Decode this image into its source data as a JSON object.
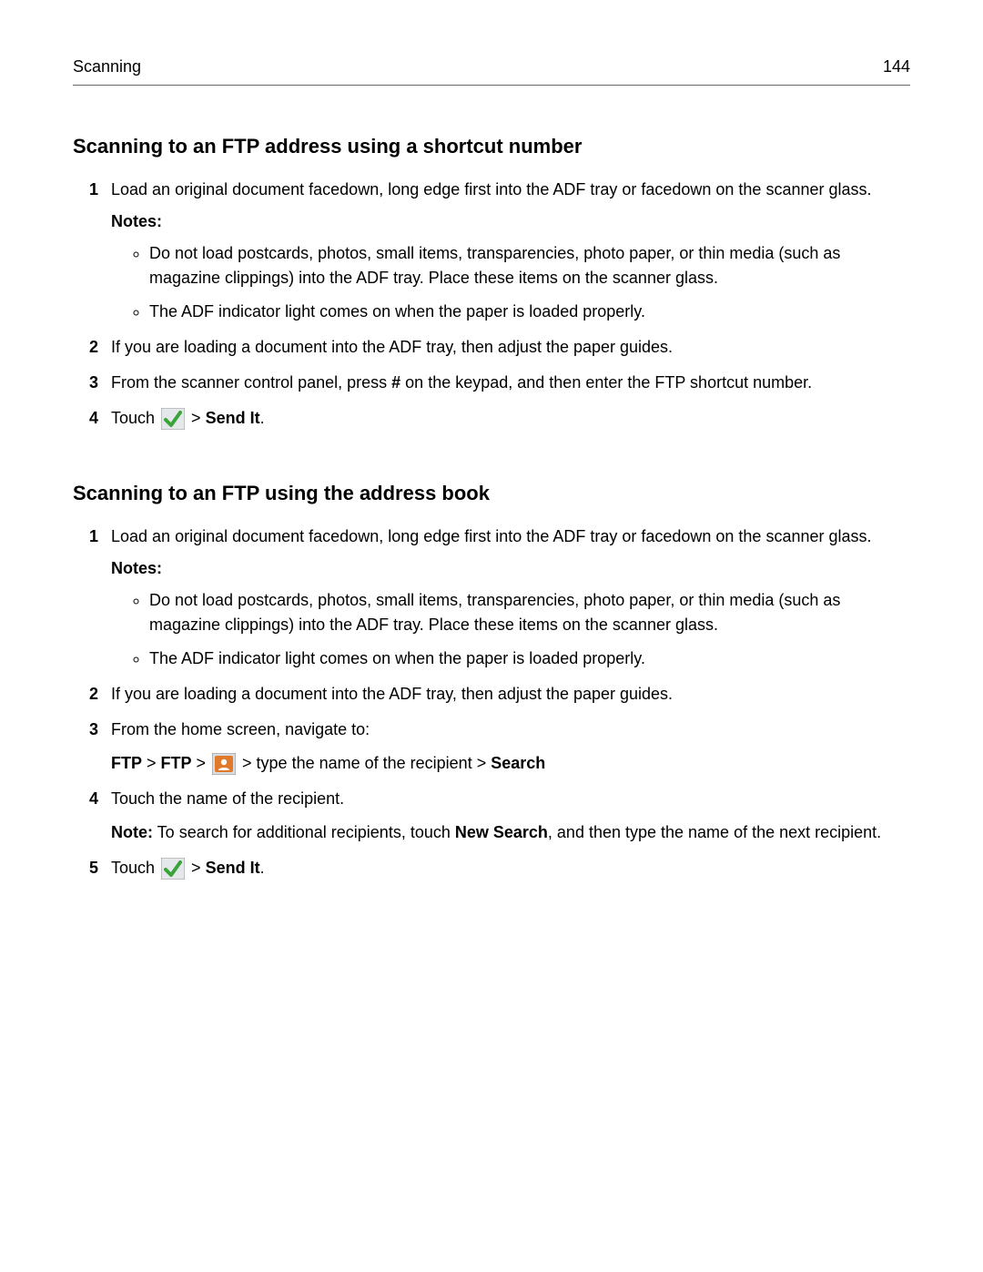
{
  "header": {
    "section": "Scanning",
    "page_number": "144"
  },
  "section_a": {
    "title": "Scanning to an FTP address using a shortcut number",
    "step1": "Load an original document facedown, long edge first into the ADF tray or facedown on the scanner glass.",
    "notes_label": "Notes:",
    "bullet1": "Do not load postcards, photos, small items, transparencies, photo paper, or thin media (such as magazine clippings) into the ADF tray. Place these items on the scanner glass.",
    "bullet2": "The ADF indicator light comes on when the paper is loaded properly.",
    "step2": "If you are loading a document into the ADF tray, then adjust the paper guides.",
    "step3_part1": "From the scanner control panel, press ",
    "step3_hash": "#",
    "step3_part2": " on the keypad, and then enter the FTP shortcut number.",
    "step4_part1": "Touch ",
    "step4_gt": " > ",
    "step4_sendit": "Send It",
    "step4_period": "."
  },
  "section_b": {
    "title": "Scanning to an FTP using the address book",
    "step1": "Load an original document facedown, long edge first into the ADF tray or facedown on the scanner glass.",
    "notes_label": "Notes:",
    "bullet1": "Do not load postcards, photos, small items, transparencies, photo paper, or thin media (such as magazine clippings) into the ADF tray. Place these items on the scanner glass.",
    "bullet2": "The ADF indicator light comes on when the paper is loaded properly.",
    "step2": "If you are loading a document into the ADF tray, then adjust the paper guides.",
    "step3": "From the home screen, navigate to:",
    "nav_ftp1": "FTP",
    "nav_gt1": " > ",
    "nav_ftp2": "FTP",
    "nav_gt2": " > ",
    "nav_gt3": " > type the name of the recipient > ",
    "nav_search": "Search",
    "step4": "Touch the name of the recipient.",
    "step4_note_label": "Note:",
    "step4_note_part1": " To search for additional recipients, touch ",
    "step4_note_newsearch": "New Search",
    "step4_note_part2": ", and then type the name of the next recipient.",
    "step5_part1": "Touch ",
    "step5_gt": " > ",
    "step5_sendit": "Send It",
    "step5_period": "."
  }
}
